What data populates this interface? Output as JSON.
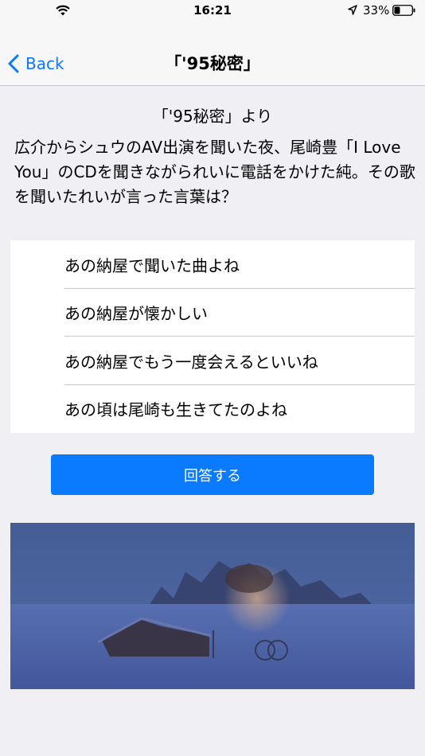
{
  "status_bar": {
    "time": "16:21",
    "battery_percent": "33%"
  },
  "nav": {
    "back_label": "Back",
    "title": "「'95秘密」"
  },
  "quiz": {
    "source": "「'95秘密」より",
    "question": "広介からシュウのAV出演を聞いた夜、尾崎豊「I Love You」のCDを聞きながられいに電話をかけた純。その歌を聞いたれいが言った言葉は？",
    "options": [
      "あの納屋で聞いた曲よね",
      "あの納屋が懐かしい",
      "あの納屋でもう一度会えるといいね",
      "あの頃は尾崎も生きてたのよね"
    ],
    "answer_button": "回答する"
  },
  "colors": {
    "accent": "#0a7aff",
    "background": "#efeff4"
  },
  "icons": [
    "wifi-icon",
    "location-arrow-icon",
    "battery-icon",
    "back-chevron-icon"
  ]
}
